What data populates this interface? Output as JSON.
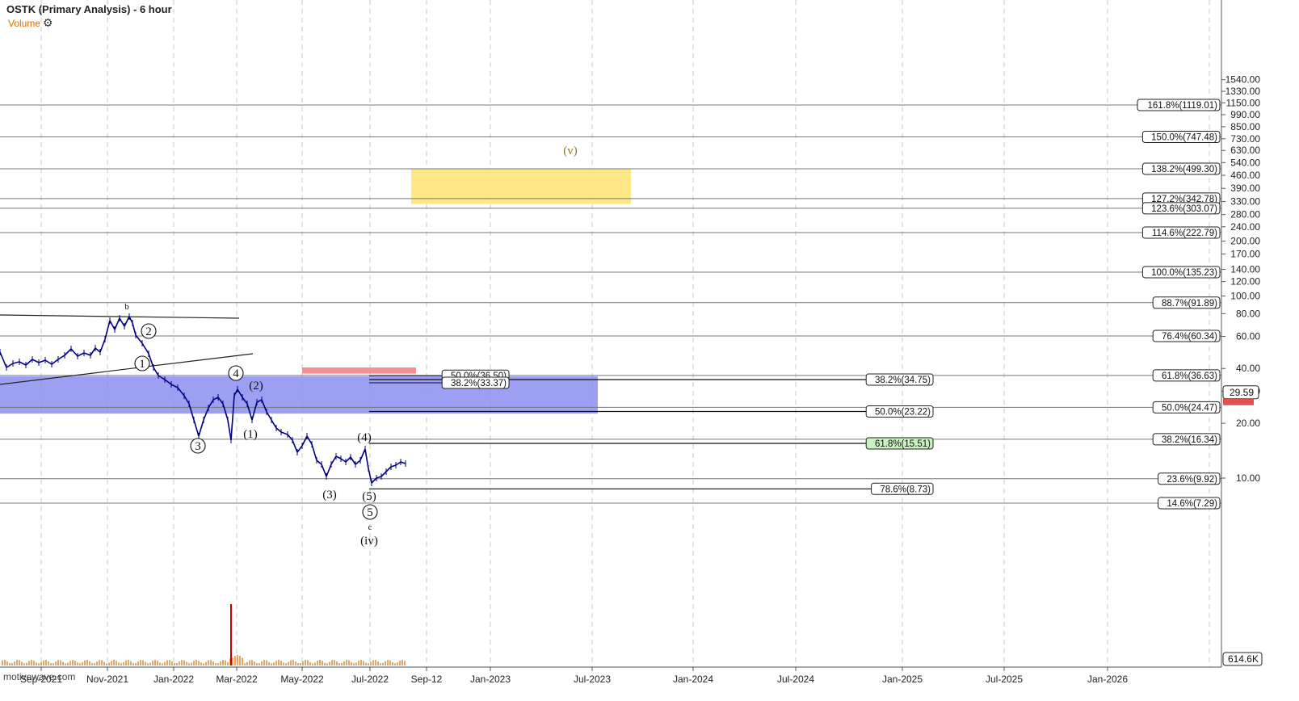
{
  "header": {
    "title": "OSTK (Primary Analysis) - 6 hour",
    "volume_label": "Volume",
    "gear_icon": "gear-icon"
  },
  "watermark": "motivewave.com",
  "chart_data": {
    "type": "candlestick",
    "y_scale": "log",
    "ylim": [
      6.5,
      1700
    ],
    "x_ticks": [
      "Sep-2021",
      "Nov-2021",
      "Jan-2022",
      "Mar-2022",
      "May-2022",
      "Jul-2022",
      "Sep-12",
      "Jan-2023",
      "Jul-2023",
      "Jan-2024",
      "Jul-2024",
      "Jan-2025",
      "Jul-2025",
      "Jan-2026"
    ],
    "y_ticks": [
      "1540.00",
      "1330.00",
      "1150.00",
      "990.00",
      "850.00",
      "730.00",
      "630.00",
      "540.00",
      "460.00",
      "390.00",
      "330.00",
      "280.00",
      "240.00",
      "200.00",
      "170.00",
      "140.00",
      "120.00",
      "100.00",
      "80.00",
      "60.00",
      "40.00",
      "30.00",
      "20.00",
      "10.00"
    ],
    "last_price": "29.59",
    "volume_tag": "614.6K",
    "fib_levels_right": [
      {
        "label": "161.8%(1119.01)",
        "value": 1119.01
      },
      {
        "label": "150.0%(747.48)",
        "value": 747.48
      },
      {
        "label": "138.2%(499.30)",
        "value": 499.3
      },
      {
        "label": "127.2%(342.78)",
        "value": 342.78
      },
      {
        "label": "123.6%(303.07)",
        "value": 303.07
      },
      {
        "label": "114.6%(222.79)",
        "value": 222.79
      },
      {
        "label": "100.0%(135.23)",
        "value": 135.23
      },
      {
        "label": "88.7%(91.89)",
        "value": 91.89
      },
      {
        "label": "76.4%(60.34)",
        "value": 60.34
      },
      {
        "label": "61.8%(36.63)",
        "value": 36.63
      },
      {
        "label": "50.0%(24.47)",
        "value": 24.47
      },
      {
        "label": "38.2%(16.34)",
        "value": 16.34
      },
      {
        "label": "23.6%(9.92)",
        "value": 9.92
      },
      {
        "label": "14.6%(7.29)",
        "value": 7.29
      }
    ],
    "fib_levels_mid": [
      {
        "label": "38.2%(34.75)",
        "value": 34.75,
        "highlight": false
      },
      {
        "label": "50.0%(23.22)",
        "value": 23.22,
        "highlight": false
      },
      {
        "label": "61.8%(15.51)",
        "value": 15.51,
        "highlight": true
      },
      {
        "label": "78.6%(8.73)",
        "value": 8.73,
        "highlight": false
      }
    ],
    "fib_levels_near": [
      {
        "label": "50.0%(36.50)",
        "value": 36.5
      },
      {
        "label": "38.2%(33.37)",
        "value": 33.37
      }
    ],
    "wave_labels": [
      {
        "text": "b",
        "circled": false
      },
      {
        "text": "2",
        "circled": true
      },
      {
        "text": "1",
        "circled": true
      },
      {
        "text": "3",
        "circled": true
      },
      {
        "text": "4",
        "circled": true
      },
      {
        "text": "(2)",
        "circled": false
      },
      {
        "text": "(1)",
        "circled": false
      },
      {
        "text": "(3)",
        "circled": false
      },
      {
        "text": "(4)",
        "circled": false
      },
      {
        "text": "(5)",
        "circled": false
      },
      {
        "text": "5",
        "circled": true
      },
      {
        "text": "c",
        "circled": false
      },
      {
        "text": "(iv)",
        "circled": false
      },
      {
        "text": "(v)",
        "circled": false
      }
    ],
    "zones": {
      "target_color": "#fde680",
      "support_color": "#8c8ff0",
      "resistance_color": "#f48a8a"
    },
    "highlight_color": "#c9f2c0",
    "price_color": "#000080",
    "volume_color": "#c00000"
  }
}
